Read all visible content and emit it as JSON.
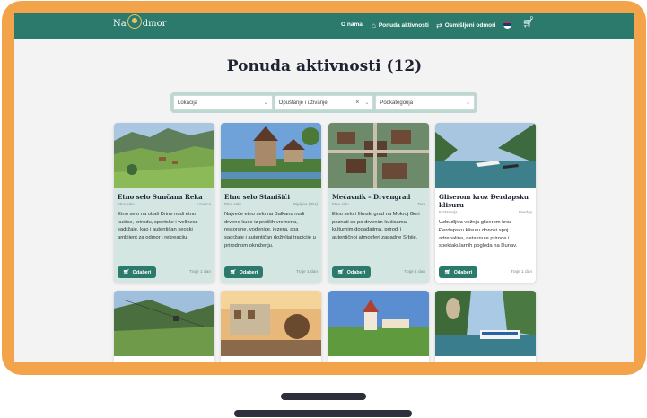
{
  "nav": {
    "logo_left": "Na",
    "logo_right": "dmor",
    "about": "O nama",
    "offers": "Ponuda aktivnosti",
    "custom": "Osmišljeni odmori",
    "cart_count": "0"
  },
  "page_title": "Ponuda aktivnosti (12)",
  "filters": {
    "location": "Lokacija",
    "category": "Opuštanje i uživanje",
    "subcategory": "Podkategorija"
  },
  "cards": [
    {
      "title": "Etno selo Sunčana Reka",
      "type": "Etno selo",
      "place": "Lovnica",
      "description": "Etno selo na obali Drine nudi etno kućice, prirodu, sportske i wellness sadržaje, kao i autentičan seoski ambijent za odmor i rekreaciju.",
      "button": "Odaberi",
      "duration": "Traje 1 dan",
      "highlighted": true
    },
    {
      "title": "Etno selo Stanišići",
      "type": "Etno selo",
      "place": "Bijeljina (BiH)",
      "description": "Najveće etno selo na Balkanu nudi drvene kuće iz prošlih vremena, restorane, vodenice, jezera, spa sadržaje i autentičan doživljaj tradicije u prirodnom okruženju.",
      "button": "Odaberi",
      "duration": "Traje 1 dan",
      "highlighted": true
    },
    {
      "title": "Mećavnik – Drvengrad",
      "type": "Etno selo",
      "place": "Tara",
      "description": "Etno selo i filmski grad na Mokroj Gori poznati su po drvenim kućicama, kulturnim događajima, prirodi i autentičnoj atmosferi zapadne Srbije.",
      "button": "Odaberi",
      "duration": "Traje 1 dan",
      "highlighted": true
    },
    {
      "title": "Gliserom kroz Đerdapsku klisuru",
      "type": "Krstarenja",
      "place": "Đerdap",
      "description": "Uzbudljiva vožnja gliserom kroz Đerdapsku klisuru donosi spoj adrenalina, netaknute prirode i spektakularnih pogleda na Dunav.",
      "button": "Odaberi",
      "duration": "Traje 1 dan",
      "highlighted": false
    }
  ]
}
